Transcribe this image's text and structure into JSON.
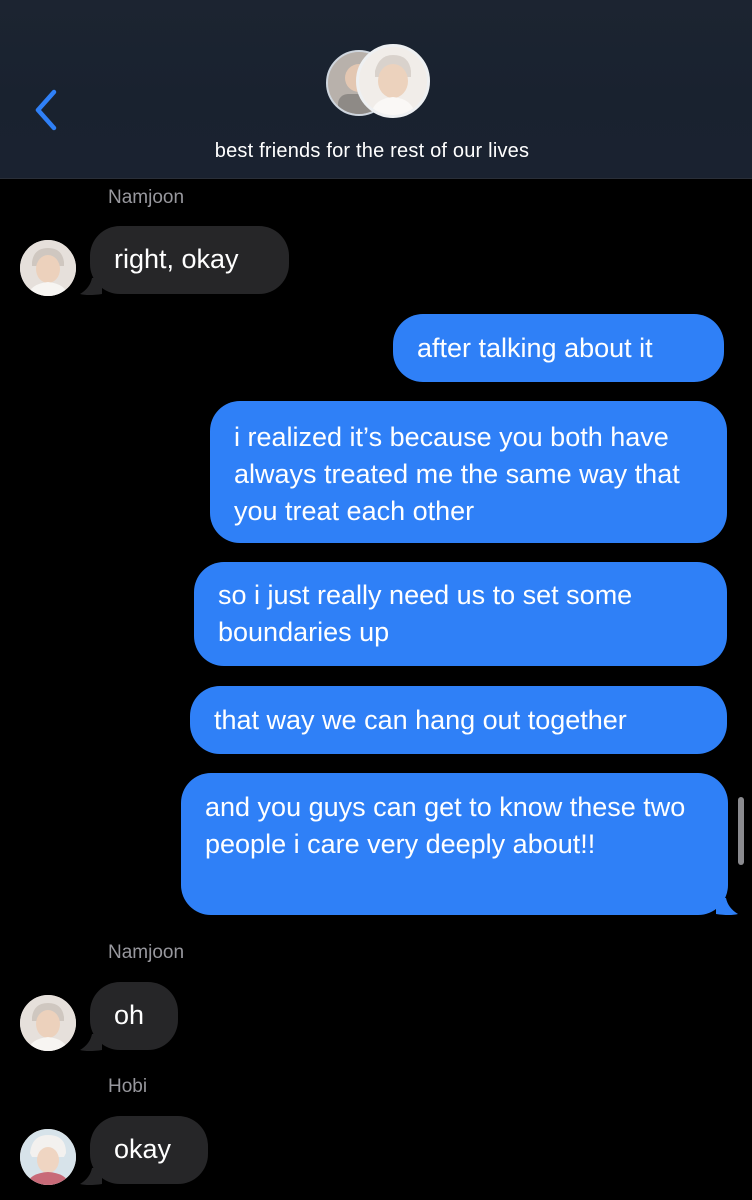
{
  "header": {
    "title": "best friends for the rest of our lives",
    "accent_color": "#2f80f7"
  },
  "messages": [
    {
      "sender": "Namjoon",
      "text": "right, okay",
      "direction": "in"
    },
    {
      "text": "after talking about it",
      "direction": "out"
    },
    {
      "text": "i realized it’s because you both have always treated me the same way that you treat each other",
      "direction": "out"
    },
    {
      "text": "so i just really need us to set some boundaries up",
      "direction": "out"
    },
    {
      "text": "that way we can hang out together",
      "direction": "out"
    },
    {
      "text": "and you guys can get to know these two people i care very deeply about!!",
      "direction": "out"
    },
    {
      "sender": "Namjoon",
      "text": "oh",
      "direction": "in"
    },
    {
      "sender": "Hobi",
      "text": "okay",
      "direction": "in"
    }
  ],
  "colors": {
    "incoming_bubble": "#262628",
    "outgoing_bubble": "#2f80f7",
    "background": "#000000"
  },
  "icons": {
    "back": "chevron-left-icon",
    "avatar_namjoon": "avatar",
    "avatar_hobi": "avatar"
  }
}
